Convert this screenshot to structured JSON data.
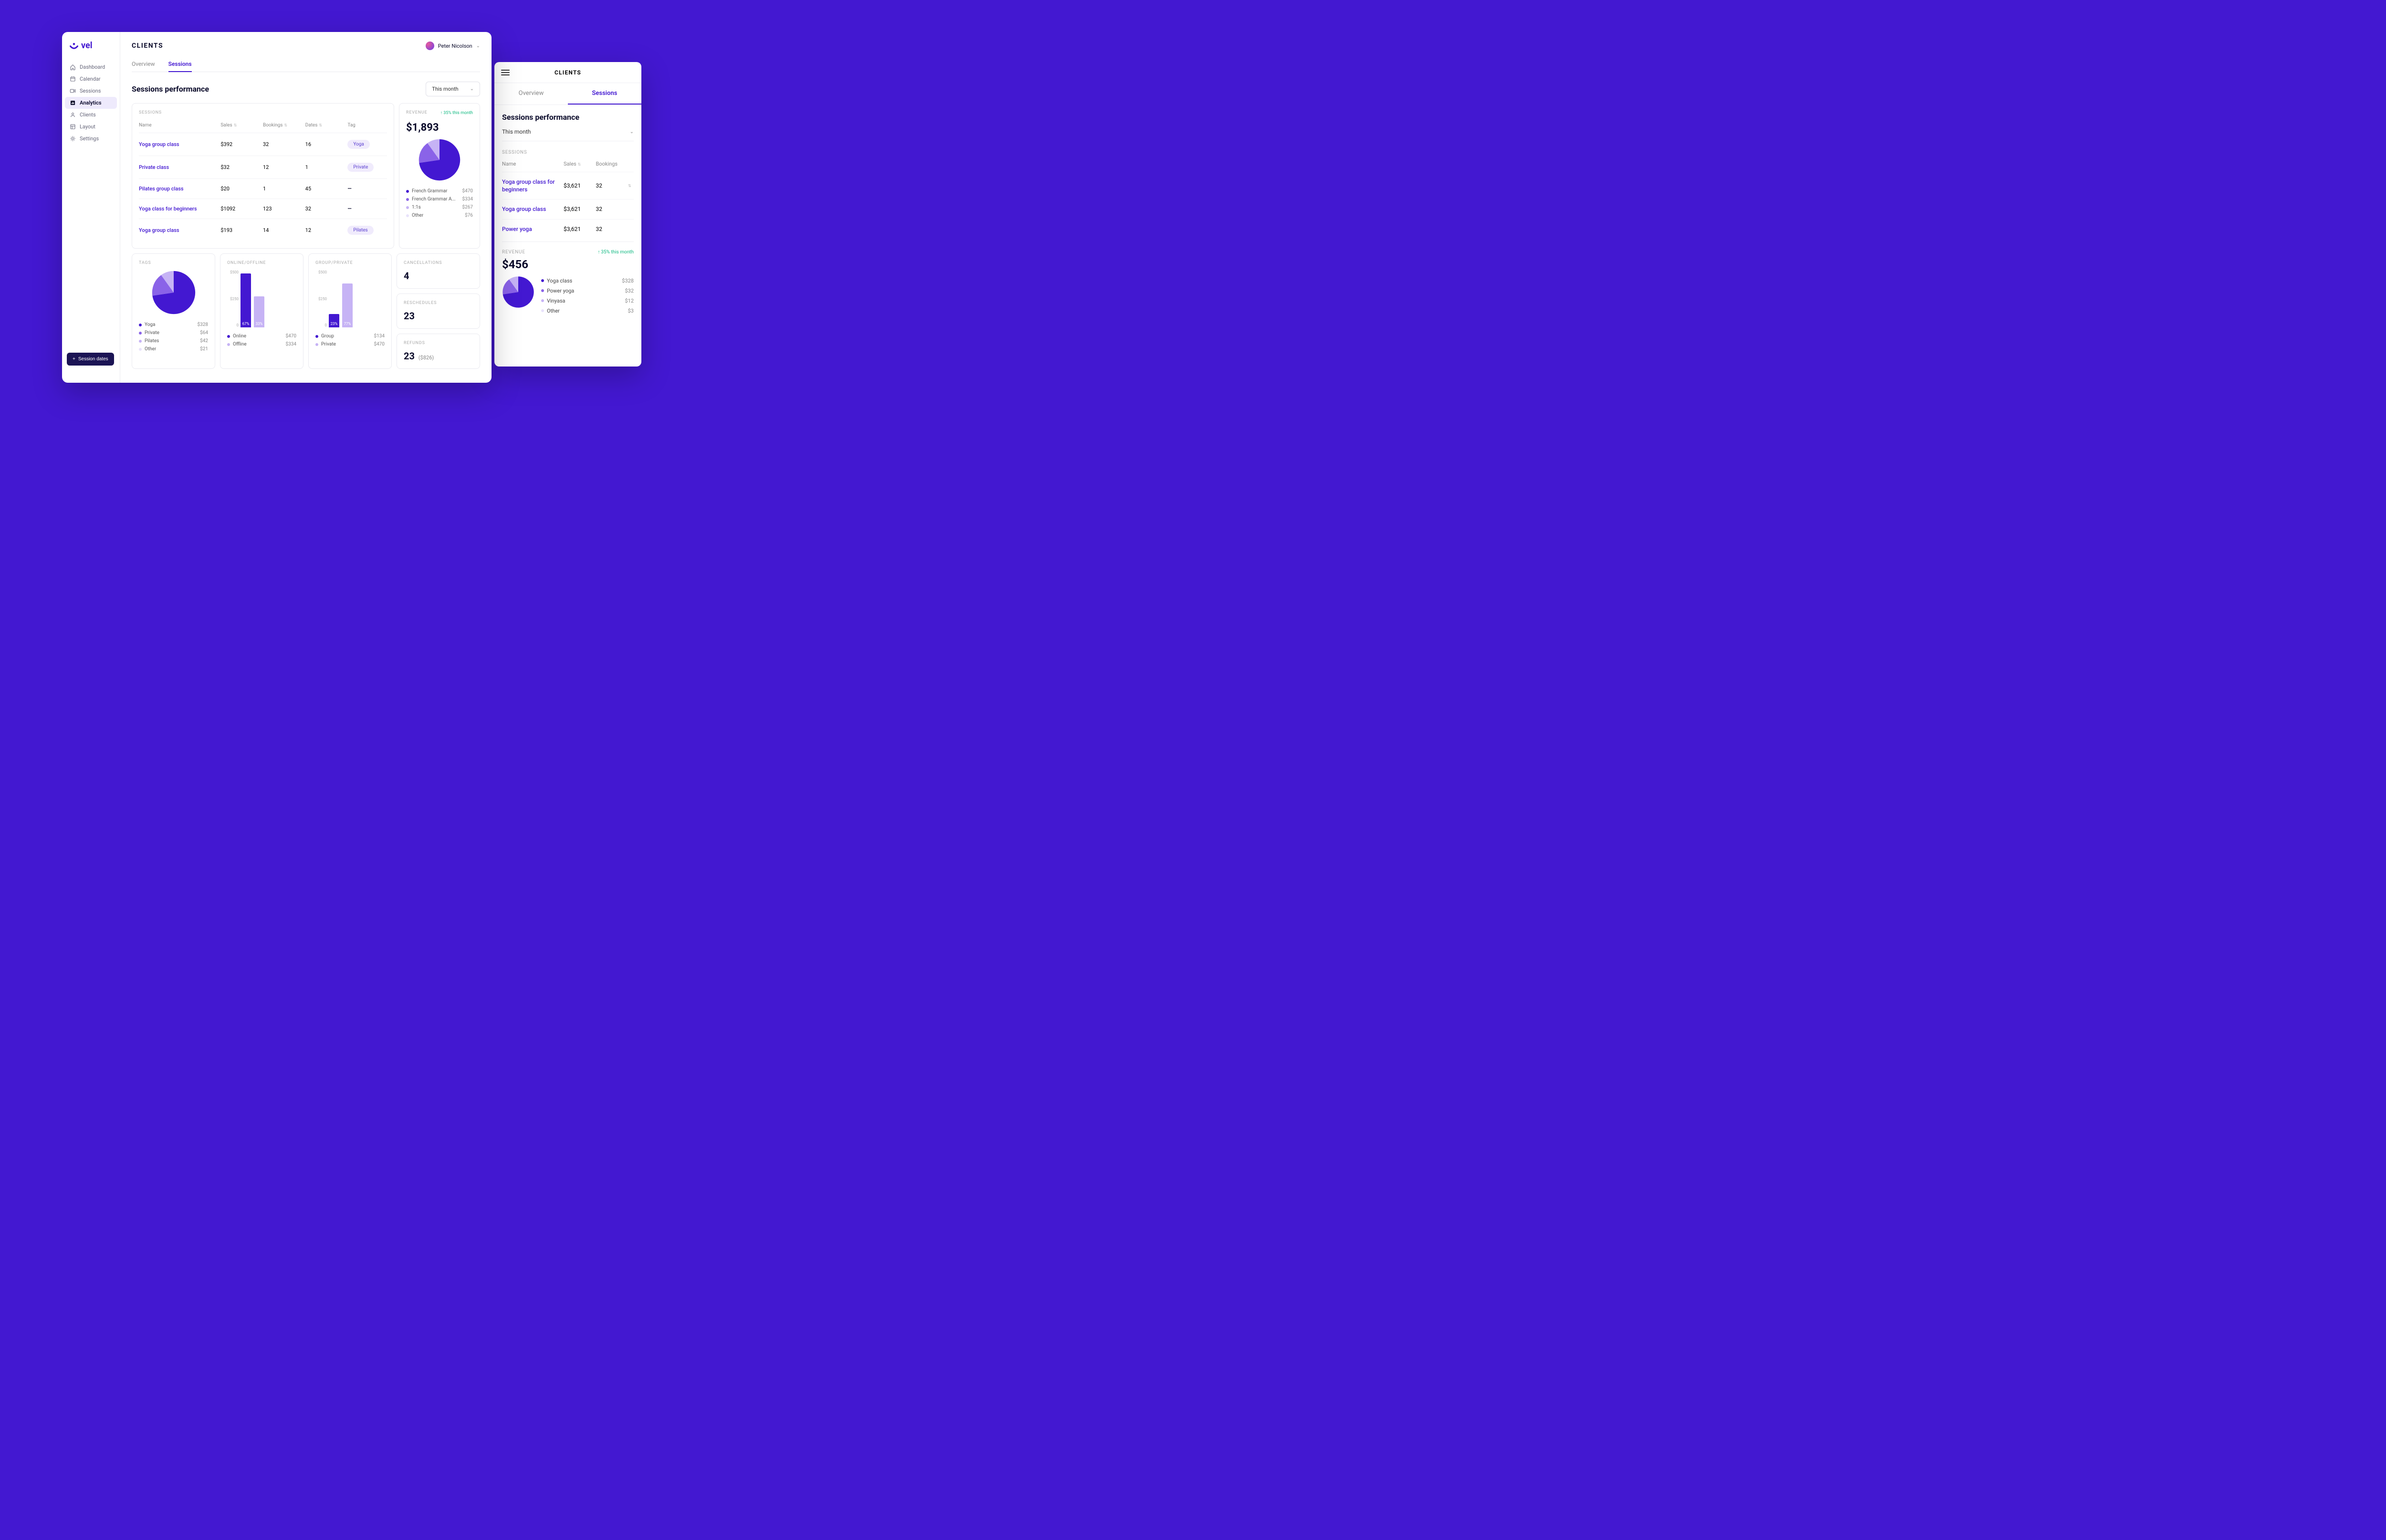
{
  "brand": "vel",
  "sidebar": {
    "items": [
      {
        "icon": "home",
        "label": "Dashboard"
      },
      {
        "icon": "calendar",
        "label": "Calendar"
      },
      {
        "icon": "video",
        "label": "Sessions"
      },
      {
        "icon": "chart",
        "label": "Analytics"
      },
      {
        "icon": "user",
        "label": "Clients"
      },
      {
        "icon": "layout",
        "label": "Layout"
      },
      {
        "icon": "gear",
        "label": "Settings"
      }
    ],
    "active_index": 3
  },
  "fab": {
    "label": "Session dates"
  },
  "header": {
    "title": "CLIENTS",
    "user": "Peter Nicolson"
  },
  "tabs": {
    "items": [
      "Overview",
      "Sessions"
    ],
    "active_index": 1
  },
  "section": {
    "title": "Sessions performance",
    "period": "This month"
  },
  "sessions_table": {
    "label": "SESSIONS",
    "columns": [
      "Name",
      "Sales",
      "Bookings",
      "Dates",
      "Tag"
    ],
    "rows": [
      {
        "name": "Yoga group class",
        "sales": "$392",
        "bookings": "32",
        "dates": "16",
        "tag": "Yoga"
      },
      {
        "name": "Private class",
        "sales": "$32",
        "bookings": "12",
        "dates": "1",
        "tag": "Private"
      },
      {
        "name": "Pilates group class",
        "sales": "$20",
        "bookings": "1",
        "dates": "45",
        "tag": "—"
      },
      {
        "name": "Yoga class for beginners",
        "sales": "$1092",
        "bookings": "123",
        "dates": "32",
        "tag": "—"
      },
      {
        "name": "Yoga group class",
        "sales": "$193",
        "bookings": "14",
        "dates": "12",
        "tag": "Pilates"
      }
    ]
  },
  "revenue": {
    "label": "REVENUE",
    "trend": "35% this month",
    "total": "$1,893",
    "legend": [
      {
        "color": "#4318D1",
        "label": "French Grammar",
        "value": "$470"
      },
      {
        "color": "#8a63e8",
        "label": "French Grammar A...",
        "value": "$334"
      },
      {
        "color": "#c6b3f5",
        "label": "1:1s",
        "value": "$267"
      },
      {
        "color": "#e8e2fb",
        "label": "Other",
        "value": "$76"
      }
    ]
  },
  "chart_data": [
    {
      "type": "pie",
      "title": "REVENUE",
      "series": [
        {
          "name": "French Grammar",
          "value": 470,
          "color": "#4318D1"
        },
        {
          "name": "French Grammar A...",
          "value": 334,
          "color": "#8a63e8"
        },
        {
          "name": "1:1s",
          "value": 267,
          "color": "#c6b3f5"
        },
        {
          "name": "Other",
          "value": 76,
          "color": "#e8e2fb"
        }
      ]
    },
    {
      "type": "pie",
      "title": "TAGS",
      "series": [
        {
          "name": "Yoga",
          "value": 328,
          "color": "#4318D1"
        },
        {
          "name": "Private",
          "value": 64,
          "color": "#8a63e8"
        },
        {
          "name": "Pilates",
          "value": 42,
          "color": "#c6b3f5"
        },
        {
          "name": "Other",
          "value": 21,
          "color": "#e8e2fb"
        }
      ]
    },
    {
      "type": "bar",
      "title": "ONLINE/OFFLINE",
      "ylabel": "",
      "ylim": [
        0,
        500
      ],
      "y_ticks": [
        "$500",
        "$250",
        "0"
      ],
      "categories": [
        "Online",
        "Offline"
      ],
      "values": [
        470,
        270
      ],
      "labels": [
        "67%",
        "33%"
      ],
      "colors": [
        "#4318D1",
        "#c6b3f5"
      ],
      "legend_values": [
        "$470",
        "$334"
      ]
    },
    {
      "type": "bar",
      "title": "GROUP/PRIVATE",
      "ylabel": "",
      "ylim": [
        0,
        500
      ],
      "y_ticks": [
        "$500",
        "$250",
        "0"
      ],
      "categories": [
        "Group",
        "Private"
      ],
      "values": [
        115,
        385
      ],
      "labels": [
        "23%",
        "77%"
      ],
      "colors": [
        "#4318D1",
        "#c6b3f5"
      ],
      "legend_values": [
        "$134",
        "$470"
      ]
    },
    {
      "type": "pie",
      "title": "REVENUE (mobile)",
      "total": 456,
      "series": [
        {
          "name": "Yoga class",
          "value": 328,
          "color": "#4318D1"
        },
        {
          "name": "Power yoga",
          "value": 32,
          "color": "#8a63e8"
        },
        {
          "name": "Vinyasa",
          "value": 12,
          "color": "#c6b3f5"
        },
        {
          "name": "Other",
          "value": 3,
          "color": "#e8e2fb"
        }
      ]
    }
  ],
  "tags_card": {
    "label": "TAGS",
    "legend": [
      {
        "color": "#4318D1",
        "label": "Yoga",
        "value": "$328"
      },
      {
        "color": "#8a63e8",
        "label": "Private",
        "value": "$64"
      },
      {
        "color": "#c6b3f5",
        "label": "Pilates",
        "value": "$42"
      },
      {
        "color": "#e8e2fb",
        "label": "Other",
        "value": "$21"
      }
    ]
  },
  "online_card": {
    "label": "ONLINE/OFFLINE",
    "y_ticks": [
      "$500",
      "$250",
      "0"
    ],
    "bars": [
      {
        "color": "#4318D1",
        "height_pct": 94,
        "label": "67%"
      },
      {
        "color": "#c6b3f5",
        "height_pct": 54,
        "label": "33%"
      }
    ],
    "legend": [
      {
        "color": "#4318D1",
        "label": "Online",
        "value": "$470"
      },
      {
        "color": "#c6b3f5",
        "label": "Offline",
        "value": "$334"
      }
    ]
  },
  "group_card": {
    "label": "GROUP/PRIVATE",
    "y_ticks": [
      "$500",
      "$250",
      "0"
    ],
    "bars": [
      {
        "color": "#4318D1",
        "height_pct": 23,
        "label": "23%"
      },
      {
        "color": "#c6b3f5",
        "height_pct": 77,
        "label": "77%"
      }
    ],
    "legend": [
      {
        "color": "#4318D1",
        "label": "Group",
        "value": "$134"
      },
      {
        "color": "#c6b3f5",
        "label": "Private",
        "value": "$470"
      }
    ]
  },
  "stats": {
    "cancellations": {
      "label": "CANCELLATIONS",
      "value": "4"
    },
    "reschedules": {
      "label": "RESCHEDULES",
      "value": "23"
    },
    "refunds": {
      "label": "REFUNDS",
      "value": "23",
      "sub": "($826)"
    }
  },
  "mobile": {
    "title": "CLIENTS",
    "tabs": {
      "items": [
        "Overview",
        "Sessions"
      ],
      "active_index": 1
    },
    "section_title": "Sessions performance",
    "period": "This month",
    "sessions_label": "SESSIONS",
    "columns": [
      "Name",
      "Sales",
      "Bookings"
    ],
    "rows": [
      {
        "name": "Yoga group class for beginners",
        "sales": "$3,621",
        "bookings": "32"
      },
      {
        "name": "Yoga group class",
        "sales": "$3,621",
        "bookings": "32"
      },
      {
        "name": "Power yoga",
        "sales": "$3,621",
        "bookings": "32"
      }
    ],
    "revenue": {
      "label": "REVENUE",
      "trend": "35% this month",
      "total": "$456",
      "legend": [
        {
          "color": "#4318D1",
          "label": "Yoga class",
          "value": "$328"
        },
        {
          "color": "#8a63e8",
          "label": "Power yoga",
          "value": "$32"
        },
        {
          "color": "#c6b3f5",
          "label": "Vinyasa",
          "value": "$12"
        },
        {
          "color": "#e8e2fb",
          "label": "Other",
          "value": "$3"
        }
      ]
    }
  }
}
